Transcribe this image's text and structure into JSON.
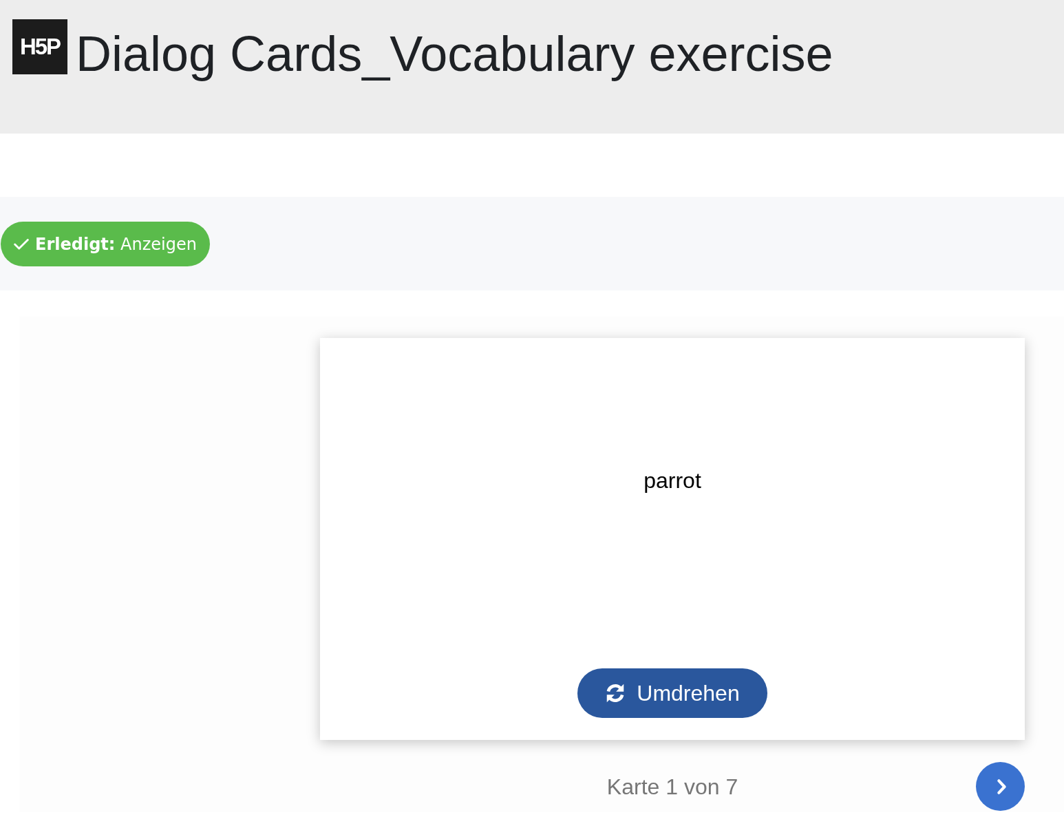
{
  "header": {
    "logo": "H5P",
    "title": "Dialog Cards_Vocabulary exercise"
  },
  "completion_badge": {
    "label": "**Erledigt:** Anzeigen",
    "completed": true
  },
  "card": {
    "text": "parrot",
    "flip_button": {
      "label": "Umdrehen"
    }
  },
  "navigation": {
    "progress": "Karte 1 von 7"
  }
}
